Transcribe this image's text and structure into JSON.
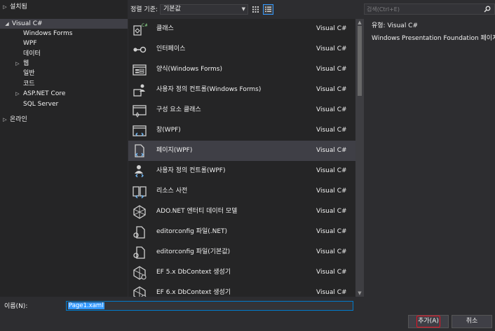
{
  "tree": {
    "installed": "설치됨",
    "visual_csharp": "Visual C#",
    "children": [
      "Windows Forms",
      "WPF",
      "데이터",
      "웹",
      "일반",
      "코드",
      "ASP.NET Core",
      "SQL Server"
    ],
    "online": "온라인"
  },
  "toolbar": {
    "sort_label": "정렬 기준:",
    "sort_value": "기본값"
  },
  "search": {
    "placeholder": "검색(Ctrl+E)"
  },
  "templates": [
    {
      "icon": "class-icon",
      "label": "클래스",
      "lang": "Visual C#"
    },
    {
      "icon": "interface-icon",
      "label": "인터페이스",
      "lang": "Visual C#"
    },
    {
      "icon": "form-icon",
      "label": "양식(Windows Forms)",
      "lang": "Visual C#"
    },
    {
      "icon": "user-control-icon",
      "label": "사용자 정의 컨트롤(Windows Forms)",
      "lang": "Visual C#"
    },
    {
      "icon": "component-class-icon",
      "label": "구성 요소 클래스",
      "lang": "Visual C#"
    },
    {
      "icon": "window-icon",
      "label": "창(WPF)",
      "lang": "Visual C#"
    },
    {
      "icon": "page-icon",
      "label": "페이지(WPF)",
      "lang": "Visual C#"
    },
    {
      "icon": "wpf-user-control-icon",
      "label": "사용자 정의 컨트롤(WPF)",
      "lang": "Visual C#"
    },
    {
      "icon": "resource-dictionary-icon",
      "label": "리소스 사전",
      "lang": "Visual C#"
    },
    {
      "icon": "ado-entity-model-icon",
      "label": "ADO.NET 엔터티 데이터 모델",
      "lang": "Visual C#"
    },
    {
      "icon": "editorconfig-icon",
      "label": "editorconfig 파일(.NET)",
      "lang": "Visual C#"
    },
    {
      "icon": "editorconfig-icon",
      "label": "editorconfig 파일(기본값)",
      "lang": "Visual C#"
    },
    {
      "icon": "ef-dbcontext-icon",
      "label": "EF 5.x DbContext 생성기",
      "lang": "Visual C#"
    },
    {
      "icon": "ef-dbcontext-icon",
      "label": "EF 6.x DbContext 생성기",
      "lang": "Visual C#"
    }
  ],
  "description": {
    "type_line": "유형:  Visual C#",
    "text": "Windows Presentation Foundation 페이지"
  },
  "name": {
    "label": "이름(N):",
    "value": "Page1.xaml"
  },
  "buttons": {
    "add": "추가(A)",
    "cancel": "취소"
  },
  "colors": {
    "accent": "#007acc",
    "selection": "#3399ff",
    "highlight_box": "#e81123",
    "icon_blue": "#75beff",
    "icon_green": "#8ddb8c"
  }
}
